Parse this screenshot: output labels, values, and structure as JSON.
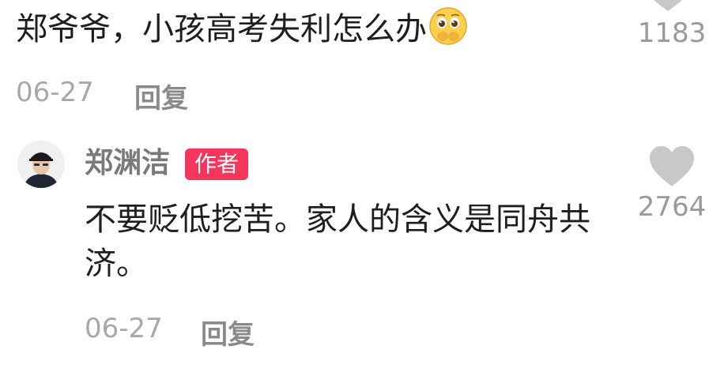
{
  "comment": {
    "text": "郑爷爷，小孩高考失利怎么办",
    "emoji": "pleading-face-emoji",
    "date": "06-27",
    "reply_label": "回复",
    "like_count": "1183"
  },
  "reply": {
    "username": "郑渊洁",
    "badge": "作者",
    "text": "不要贬低挖苦。家人的含义是同舟共济。",
    "date": "06-27",
    "reply_label": "回复",
    "like_count": "2764"
  },
  "colors": {
    "badge": "#f5365c",
    "heart": "#c8c8c8",
    "text": "#1e1e1e",
    "muted": "#a8a8a8"
  }
}
